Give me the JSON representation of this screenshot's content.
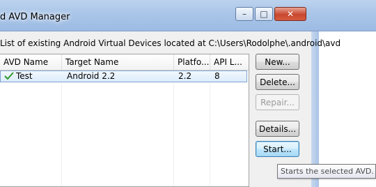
{
  "window": {
    "title": "d AVD Manager",
    "minimize_glyph": "–",
    "maximize_glyph": "□",
    "close_glyph": "✕"
  },
  "list_label": "List of existing Android Virtual Devices located at C:\\Users\\Rodolphe\\.android\\avd",
  "table": {
    "columns": [
      "AVD Name",
      "Target Name",
      "Platfo...",
      "API L..."
    ],
    "rows": [
      {
        "status_icon": "check-icon",
        "avd_name": "Test",
        "target": "Android 2.2",
        "platform": "2.2",
        "api": "8"
      }
    ]
  },
  "buttons": {
    "new": "New...",
    "delete": "Delete...",
    "repair": "Repair...",
    "details": "Details...",
    "start": "Start..."
  },
  "tooltip": "Starts the selected AVD.",
  "colors": {
    "selection_border": "#7da2ce",
    "check_green": "#2e9a2e",
    "close_red": "#c8472f"
  }
}
